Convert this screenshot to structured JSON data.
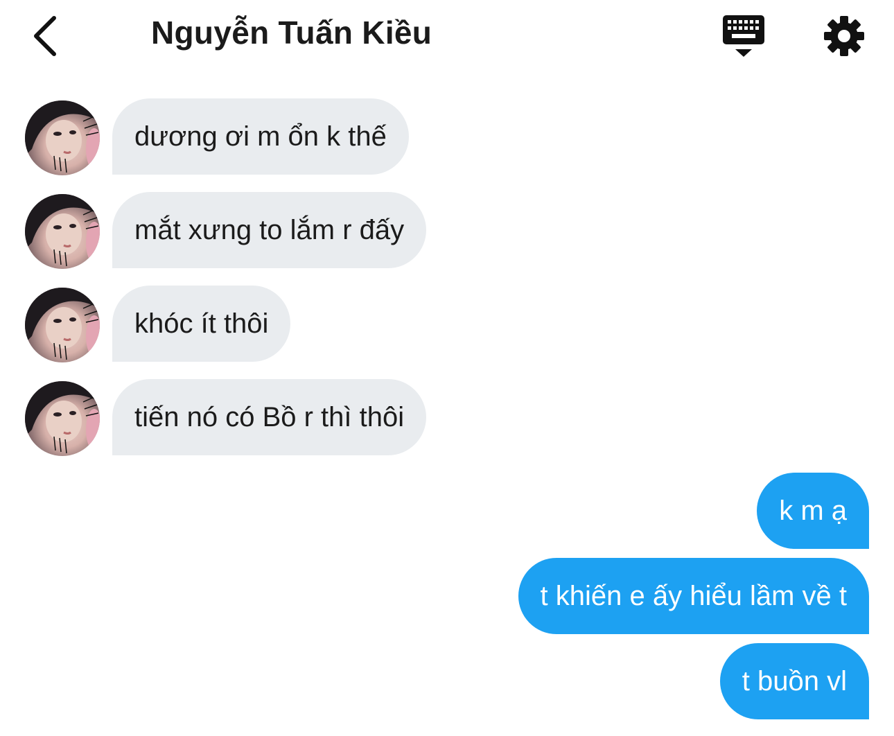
{
  "header": {
    "title": "Nguyễn Tuấn Kiều",
    "back_icon": "chevron-left-icon",
    "keyboard_icon": "keyboard-icon",
    "settings_icon": "gear-icon"
  },
  "colors": {
    "incoming_bubble": "#e9ecef",
    "outgoing_bubble": "#1da1f2",
    "text_dark": "#1b1b1b",
    "text_light": "#ffffff"
  },
  "messages": {
    "incoming": [
      {
        "text": "dương ơi m ổn k thế"
      },
      {
        "text": "mắt xưng to lắm r đấy"
      },
      {
        "text": "khóc ít thôi"
      },
      {
        "text": "tiến nó có Bồ r thì thôi"
      }
    ],
    "outgoing": [
      {
        "text": "k m ạ"
      },
      {
        "text": "t khiến e ấy hiểu lầm về t"
      },
      {
        "text": "t buồn vl"
      }
    ]
  }
}
